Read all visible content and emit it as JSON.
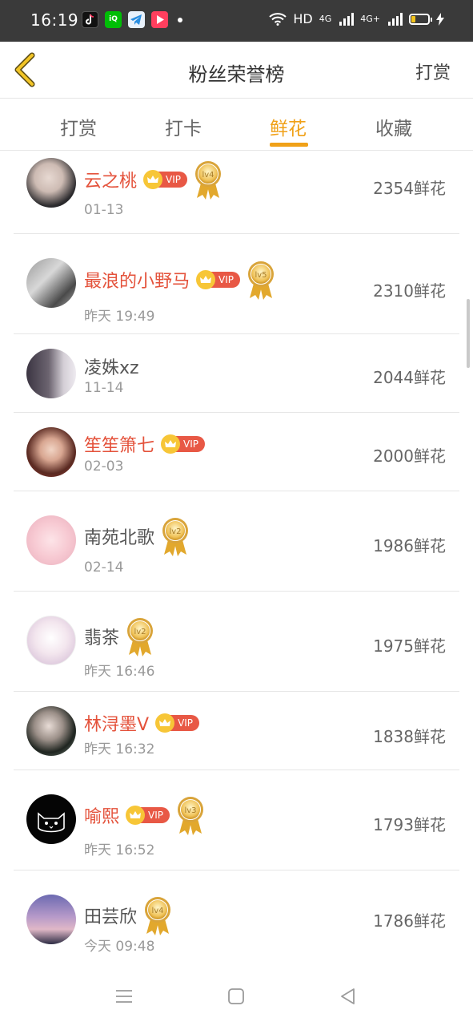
{
  "status_bar": {
    "time": "16:19",
    "network": "HD",
    "signal1": "4G",
    "signal2": "4G+"
  },
  "header": {
    "title": "粉丝荣誉榜",
    "action": "打赏"
  },
  "tabs": [
    {
      "label": "打赏",
      "active": false
    },
    {
      "label": "打卡",
      "active": false
    },
    {
      "label": "鲜花",
      "active": true
    },
    {
      "label": "收藏",
      "active": false
    }
  ],
  "vip_label": "VIP",
  "entries": [
    {
      "name": "云之桃",
      "vip": true,
      "level": "lv4",
      "date": "01-13",
      "count": "2354鲜花"
    },
    {
      "name": "最浪的小野马",
      "vip": true,
      "level": "lv5",
      "date": "昨天 19:49",
      "count": "2310鲜花"
    },
    {
      "name": "凌姝xz",
      "vip": false,
      "level": "",
      "date": "11-14",
      "count": "2044鲜花"
    },
    {
      "name": "笙笙箫七",
      "vip": true,
      "level": "",
      "date": "02-03",
      "count": "2000鲜花"
    },
    {
      "name": "南苑北歌",
      "vip": false,
      "level": "lv2",
      "date": "02-14",
      "count": "1986鲜花"
    },
    {
      "name": "翡茶",
      "vip": false,
      "level": "lv2",
      "date": "昨天 16:46",
      "count": "1975鲜花"
    },
    {
      "name": "林浔墨V",
      "vip": true,
      "level": "",
      "date": "昨天 16:32",
      "count": "1838鲜花"
    },
    {
      "name": "喻熙",
      "vip": true,
      "level": "lv3",
      "date": "昨天 16:52",
      "count": "1793鲜花"
    },
    {
      "name": "田芸欣",
      "vip": false,
      "level": "lv4",
      "date": "今天 09:48",
      "count": "1786鲜花"
    }
  ],
  "colors": {
    "accent": "#f0a118",
    "vip_name": "#e4523b",
    "vip_badge": "#e85845",
    "crown": "#f7c637"
  }
}
